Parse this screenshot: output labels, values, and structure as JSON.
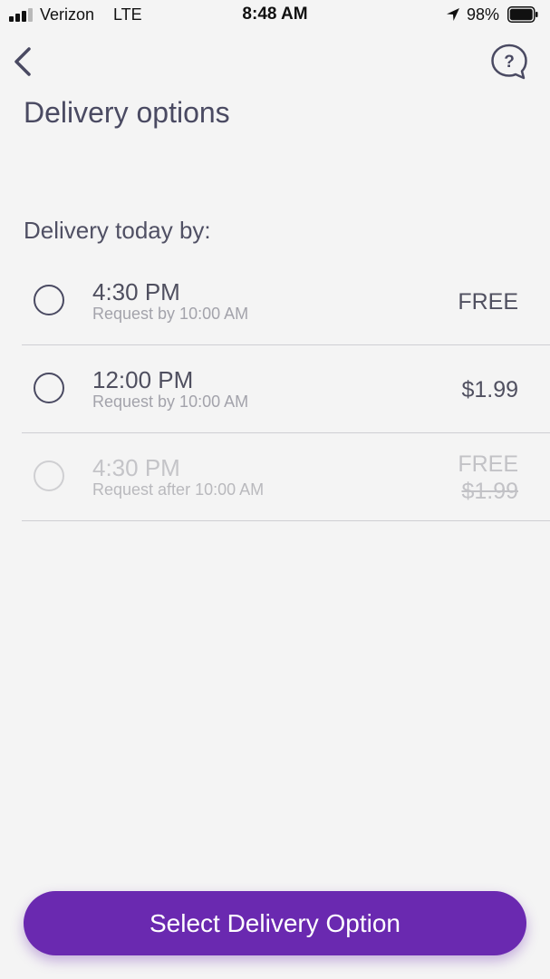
{
  "status_bar": {
    "carrier": "Verizon",
    "network": "LTE",
    "time": "8:48 AM",
    "battery_percent": "98%",
    "signal_bars": 3,
    "battery_level": 0.98,
    "icons": [
      "signal-icon",
      "location-arrow-icon",
      "battery-icon"
    ]
  },
  "nav": {
    "back_icon": "chevron-left-icon",
    "help_icon": "question-bubble-icon"
  },
  "page": {
    "title": "Delivery options",
    "section_heading": "Delivery today by:"
  },
  "options": [
    {
      "time": "4:30 PM",
      "subtitle": "Request by 10:00 AM",
      "price": "FREE",
      "enabled": true
    },
    {
      "time": "12:00 PM",
      "subtitle": "Request by 10:00 AM",
      "price": "$1.99",
      "enabled": true
    },
    {
      "time": "4:30 PM",
      "subtitle": "Request after 10:00 AM",
      "price": "FREE",
      "original_price": "$1.99",
      "enabled": false
    }
  ],
  "primary_button": {
    "label": "Select Delivery Option"
  },
  "colors": {
    "accent": "#6a29b0",
    "background": "#f4f4f4",
    "text_primary": "#4a4a62",
    "text_disabled": "#c4c4c8"
  }
}
